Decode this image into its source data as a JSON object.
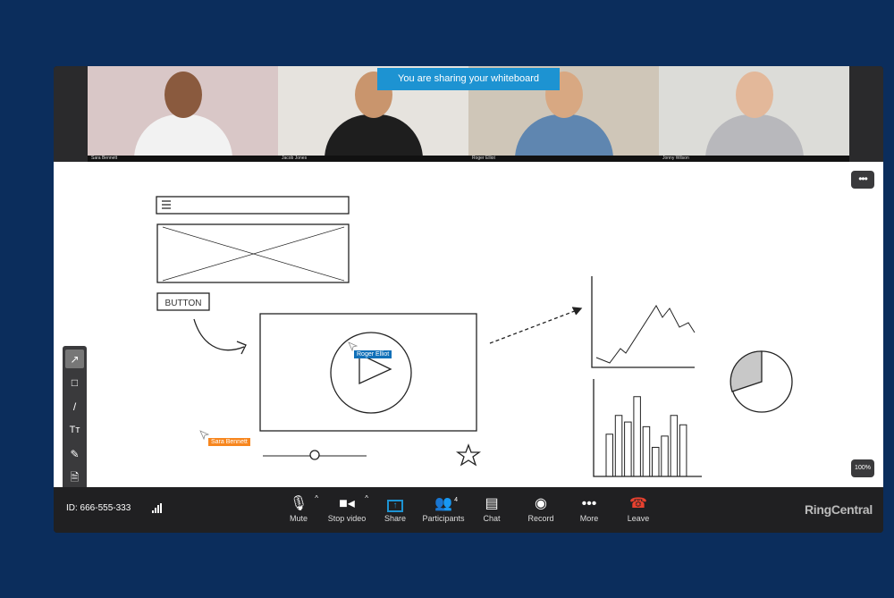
{
  "banner": "You are sharing your whiteboard",
  "participants": [
    {
      "name": "Sara Bennett",
      "bg": "#d9c7c7",
      "skin": "#8a5a3e",
      "shirt": "#f2f2f2",
      "active": true
    },
    {
      "name": "Jacob Jones",
      "bg": "#e6e3de",
      "skin": "#c9956d",
      "shirt": "#1e1e1e"
    },
    {
      "name": "Roger Elliot",
      "bg": "#cfc6b8",
      "skin": "#d8a882",
      "shirt": "#5f86b0"
    },
    {
      "name": "Jonny Wilson",
      "bg": "#dcdcd8",
      "skin": "#e3b89a",
      "shirt": "#b8b8bc"
    }
  ],
  "whiteboard": {
    "button_sketch": "BUTTON",
    "cursors": [
      {
        "name": "Roger Elliot",
        "color": "#1170b8"
      },
      {
        "name": "Sara Bennett",
        "color": "#f7861e"
      }
    ],
    "more": "•••",
    "zoom": "100%",
    "tools": [
      "arrow",
      "rectangle",
      "line",
      "text",
      "pencil",
      "document"
    ]
  },
  "toolbar": {
    "meeting_id": "ID: 666-555-333",
    "buttons": [
      {
        "label": "Mute"
      },
      {
        "label": "Stop video"
      },
      {
        "label": "Share"
      },
      {
        "label": "Participants",
        "badge": "4"
      },
      {
        "label": "Chat"
      },
      {
        "label": "Record"
      },
      {
        "label": "More"
      },
      {
        "label": "Leave"
      }
    ],
    "brand": "RingCentral"
  },
  "colors": {
    "accent": "#1d93d2",
    "leave": "#e8412f"
  }
}
